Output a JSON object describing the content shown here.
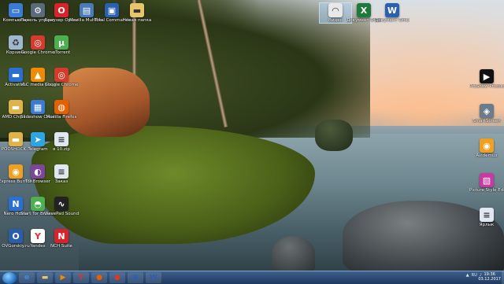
{
  "desktop": {
    "icons_left_col1": [
      {
        "label": "Компьютер",
        "icon": "computer-icon",
        "color": "#3a7bd5"
      },
      {
        "label": "Корзина",
        "icon": "recycle-bin-icon",
        "color": "#9fb8d0"
      },
      {
        "label": "Activators",
        "icon": "folder-icon",
        "color": "#2b6fd1"
      },
      {
        "label": "AMD Chips...",
        "icon": "folder-icon",
        "color": "#e0b24a"
      },
      {
        "label": "POOSHOCK...",
        "icon": "folder-icon",
        "color": "#e0b24a"
      },
      {
        "label": "Express Burn Disc Burnin...",
        "icon": "disc-burn-icon",
        "color": "#f0a020"
      },
      {
        "label": "Nero Home",
        "icon": "nero-icon",
        "color": "#2b6fd1"
      },
      {
        "label": "OVGorskiy.ru",
        "icon": "ovgorskiy-icon",
        "color": "#2a5ea8"
      }
    ],
    "icons_left_col2": [
      {
        "label": "Панель управления",
        "icon": "settings-gear-icon",
        "color": "#5a6a7a"
      },
      {
        "label": "Google Chrome",
        "icon": "chrome-icon",
        "color": "#d33b2c"
      },
      {
        "label": "VLC media player",
        "icon": "vlc-icon",
        "color": "#f08a00"
      },
      {
        "label": "Slideshow Creator",
        "icon": "slideshow-icon",
        "color": "#3a7bd5"
      },
      {
        "label": "Telegram",
        "icon": "telegram-icon",
        "color": "#2ca5e0"
      },
      {
        "label": "Tor Browser",
        "icon": "tor-browser-icon",
        "color": "#7d4698"
      },
      {
        "label": "Start Tor Browser",
        "icon": "tor-start-icon",
        "color": "#4caf50"
      },
      {
        "label": "Yandex",
        "icon": "yandex-icon",
        "color": "#ffffff"
      }
    ],
    "icons_left_col3": [
      {
        "label": "Браузер Opera",
        "icon": "opera-icon",
        "color": "#d8232a"
      },
      {
        "label": "uTorrent",
        "icon": "utorrent-icon",
        "color": "#4caf50"
      },
      {
        "label": "Google Chrome",
        "icon": "chrome-icon",
        "color": "#d33b2c"
      },
      {
        "label": "Mozilla Firefox",
        "icon": "firefox-icon",
        "color": "#e66000"
      },
      {
        "label": "в 10.zip",
        "icon": "document-icon",
        "color": "#dfe7f0"
      },
      {
        "label": "Заказ",
        "icon": "document-icon",
        "color": "#dfe7f0"
      },
      {
        "label": "WavePad Sound Editor",
        "icon": "wavepad-icon",
        "color": "#222222"
      },
      {
        "label": "NCH Suite",
        "icon": "nch-icon",
        "color": "#d8232a"
      }
    ],
    "icons_top_row": [
      {
        "label": "Mozilla Multifile...",
        "icon": "multifile-icon",
        "color": "#4a7ab8"
      },
      {
        "label": "Total Commander",
        "icon": "floppy-icon",
        "color": "#2b5fb0"
      },
      {
        "label": "Новая папка",
        "icon": "folder-icon",
        "color": "#e8c46a"
      }
    ],
    "icons_top_middle": [
      {
        "label": "Видео",
        "icon": "video-icon",
        "color": "#e8e8e8",
        "selected": true
      },
      {
        "label": "Документ Office Эл...",
        "icon": "excel-icon",
        "color": "#1e7a3c"
      },
      {
        "label": "Документ Office Wor...",
        "icon": "word-icon",
        "color": "#2b5fb0"
      }
    ],
    "icons_right": [
      {
        "label": "ProShow Producer",
        "icon": "proshow-icon",
        "color": "#111111"
      },
      {
        "label": "SmartScreen",
        "icon": "shield-icon",
        "color": "#6a7b8c"
      },
      {
        "label": "Avidemux",
        "icon": "avidemux-icon",
        "color": "#f0a020"
      },
      {
        "label": "Picture Style Editor",
        "icon": "picture-style-icon",
        "color": "#c83aa0"
      },
      {
        "label": "Ярлык",
        "icon": "document-icon",
        "color": "#dfe7f0"
      }
    ]
  },
  "taskbar": {
    "buttons": [
      {
        "name": "internet-explorer-icon",
        "glyph": "e",
        "color": "#3a8fe0"
      },
      {
        "name": "explorer-folder-icon",
        "glyph": "▬",
        "color": "#e8c46a"
      },
      {
        "name": "media-player-icon",
        "glyph": "▶",
        "color": "#f08a00"
      },
      {
        "name": "yandex-browser-icon",
        "glyph": "Y",
        "color": "#e0322a"
      },
      {
        "name": "firefox-icon",
        "glyph": "●",
        "color": "#e66000"
      },
      {
        "name": "chrome-icon",
        "glyph": "●",
        "color": "#d33b2c"
      },
      {
        "name": "floppy-icon",
        "glyph": "▣",
        "color": "#2b5fb0"
      },
      {
        "name": "word-icon",
        "glyph": "W",
        "color": "#2b5fb0"
      }
    ],
    "tray": {
      "lang": "RU"
    },
    "clock": {
      "time": "19:36",
      "date": "03.12.2017"
    }
  }
}
